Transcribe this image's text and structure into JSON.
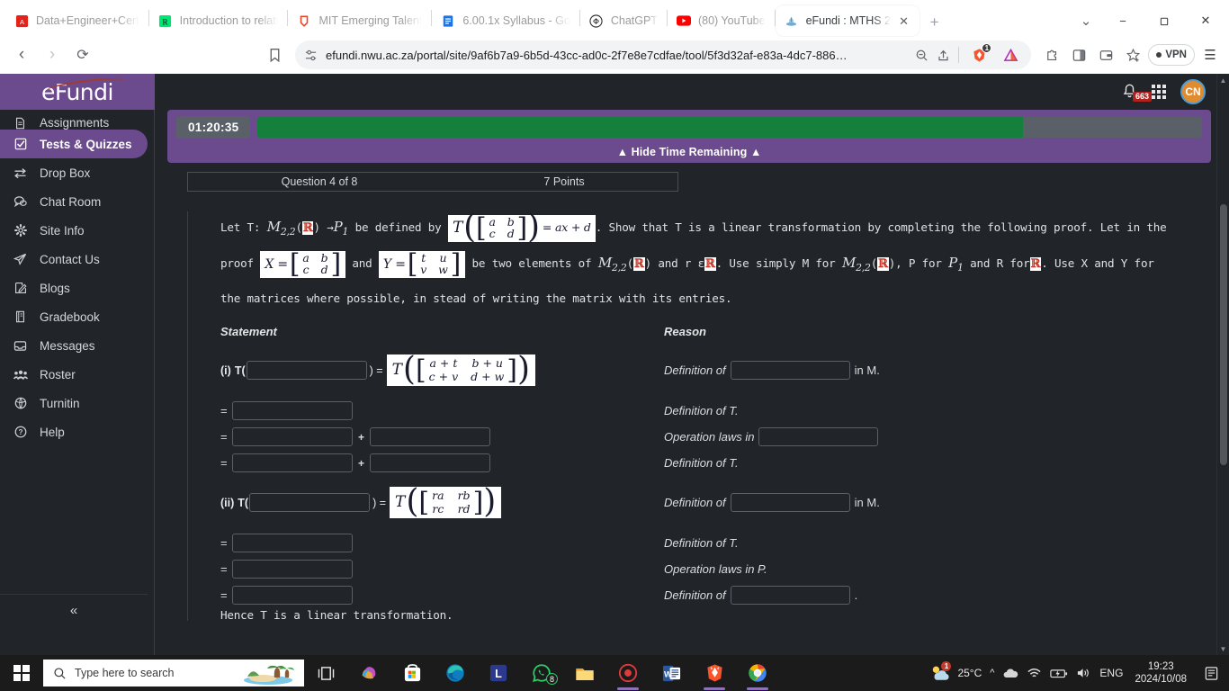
{
  "browser": {
    "tabs": [
      {
        "title": "Data+Engineer+Cert",
        "favicon": "pdf-icon",
        "active": false
      },
      {
        "title": "Introduction to relati",
        "favicon": "rstudio-icon",
        "active": false
      },
      {
        "title": "MIT Emerging Talent",
        "favicon": "notion-icon",
        "active": false
      },
      {
        "title": "6.00.1x Syllabus - Go",
        "favicon": "google-docs-icon",
        "active": false
      },
      {
        "title": "ChatGPT",
        "favicon": "chatgpt-icon",
        "active": false
      },
      {
        "title": "(80) YouTube",
        "favicon": "youtube-icon",
        "active": false
      },
      {
        "title": "eFundi : MTHS 2",
        "favicon": "efundi-icon",
        "active": true
      }
    ],
    "new_tab_label": "+",
    "tab_close_label": "✕",
    "tab_search_label": "⌄",
    "window_minimize": "−",
    "window_maximize": "❐",
    "window_close": "✕",
    "nav": {
      "back": "‹",
      "forward": "›",
      "reload": "⟳",
      "bookmark": "bookmark-icon"
    },
    "url": "efundi.nwu.ac.za/portal/site/9af6b7a9-6b5d-43cc-ad0c-2f7e8e7cdfae/tool/5f3d32af-e83a-4dc7-886…",
    "url_permission_icon": "site-settings-icon",
    "url_zoom_icon": "zoom-out-icon",
    "url_share_icon": "share-icon",
    "extensions": [
      {
        "name": "brave-rewards-icon",
        "badge": "1"
      },
      {
        "name": "triangle-extension-icon",
        "badge": ""
      }
    ],
    "toolbar_right": [
      "extensions-puzzle-icon",
      "sidebar-icon",
      "wallet-icon",
      "bookmark-add-icon"
    ],
    "vpn_label": "VPN",
    "menu_label": "☰"
  },
  "sidebar": {
    "brand": "eFundi",
    "items": [
      {
        "label": "Assignments",
        "icon": "document-icon",
        "active": false
      },
      {
        "label": "Tests & Quizzes",
        "icon": "checkbox-icon",
        "active": true
      },
      {
        "label": "Drop Box",
        "icon": "transfer-icon",
        "active": false
      },
      {
        "label": "Chat Room",
        "icon": "chat-icon",
        "active": false
      },
      {
        "label": "Site Info",
        "icon": "gear-icon",
        "active": false
      },
      {
        "label": "Contact Us",
        "icon": "paper-plane-icon",
        "active": false
      },
      {
        "label": "Blogs",
        "icon": "pencil-square-icon",
        "active": false
      },
      {
        "label": "Gradebook",
        "icon": "book-icon",
        "active": false
      },
      {
        "label": "Messages",
        "icon": "inbox-icon",
        "active": false
      },
      {
        "label": "Roster",
        "icon": "people-icon",
        "active": false
      },
      {
        "label": "Turnitin",
        "icon": "globe-icon",
        "active": false
      },
      {
        "label": "Help",
        "icon": "question-circle-icon",
        "active": false
      }
    ],
    "collapse_label": "«"
  },
  "header": {
    "notification_icon": "bell-icon",
    "notification_count": "663",
    "apps_icon": "grid-icon",
    "avatar_initials": "CN"
  },
  "assessment": {
    "timer": "01:20:35",
    "timer_progress_percent": 81,
    "hide_time_label": "▲ Hide Time Remaining ▲",
    "question_number": "Question 4 of 8",
    "points": "7 Points"
  },
  "question": {
    "line1_a": "Let T:",
    "line1_b": "M",
    "line1_sub": "2,2",
    "line1_c": "(",
    "line1_d": ")",
    "line1_arrow": "→",
    "line1_p": "P",
    "line1_psub": "1",
    "line1_e": "be defined by",
    "formula_T": "T",
    "formula_matrix": [
      [
        "a",
        "b"
      ],
      [
        "c",
        "d"
      ]
    ],
    "formula_rhs": "= ax + d",
    "line1_f": ". Show that T is a linear transformation by completing the following proof. Let",
    "line2_a": "in the proof",
    "line2_X": "X =",
    "matrix_X": [
      [
        "a",
        "b"
      ],
      [
        "c",
        "d"
      ]
    ],
    "line2_and": "and",
    "line2_Y": "Y =",
    "matrix_Y": [
      [
        "t",
        "u"
      ],
      [
        "v",
        "w"
      ]
    ],
    "line2_b": "be two elements of",
    "line2_c": "and r ε",
    "line2_d": ". Use simply M for",
    "line2_e": ", P for",
    "line2_f": "and R for",
    "line2_g": ". Use X",
    "line3": "and Y for the matrices where possible, in stead of writing the matrix with its entries.",
    "real_symbol": "ℝ"
  },
  "proof": {
    "col_statement": "Statement",
    "col_reason": "Reason",
    "part_i_label": "(i)",
    "part_ii_label": "(ii)",
    "t_open": "T(",
    "t_close": ") =",
    "equals": "=",
    "plus": "+",
    "matrix_i": [
      [
        "a + t",
        "b + u"
      ],
      [
        "c + v",
        "d + w"
      ]
    ],
    "matrix_ii": [
      [
        "ra",
        "rb"
      ],
      [
        "rc",
        "rd"
      ]
    ],
    "reason_definition_of": "Definition of",
    "reason_in_m": "in M.",
    "reason_definition_of_t": "Definition of T.",
    "reason_operation_laws_in": "Operation laws in",
    "reason_operation_laws_in_p": "Operation laws in P.",
    "reason_period": ".",
    "conclusion": "Hence T is a linear transformation.",
    "input_value": ""
  },
  "taskbar": {
    "search_placeholder": "Type here to search",
    "search_icon": "search-icon",
    "start_icon": "windows-start-icon",
    "apps": [
      {
        "name": "task-view-icon"
      },
      {
        "name": "copilot-icon"
      },
      {
        "name": "microsoft-store-icon"
      },
      {
        "name": "microsoft-edge-icon"
      },
      {
        "name": "lastpass-icon"
      },
      {
        "name": "whatsapp-icon",
        "badge": "8"
      },
      {
        "name": "file-explorer-icon"
      },
      {
        "name": "screen-recorder-icon"
      },
      {
        "name": "microsoft-word-icon"
      },
      {
        "name": "brave-browser-icon"
      },
      {
        "name": "chrome-canary-icon"
      }
    ],
    "weather_temp": "25°C",
    "weather_badge": "1",
    "tray_icons": [
      "chevron-up-icon",
      "onedrive-icon",
      "wifi-icon",
      "battery-icon",
      "volume-icon"
    ],
    "language": "ENG",
    "time": "19:23",
    "date": "2024/10/08",
    "notification_center_icon": "notification-center-icon"
  },
  "colors": {
    "brand_purple": "#6b4a8e",
    "progress_green": "#14803c",
    "page_bg": "#212529",
    "badge_red": "#b3201d"
  }
}
